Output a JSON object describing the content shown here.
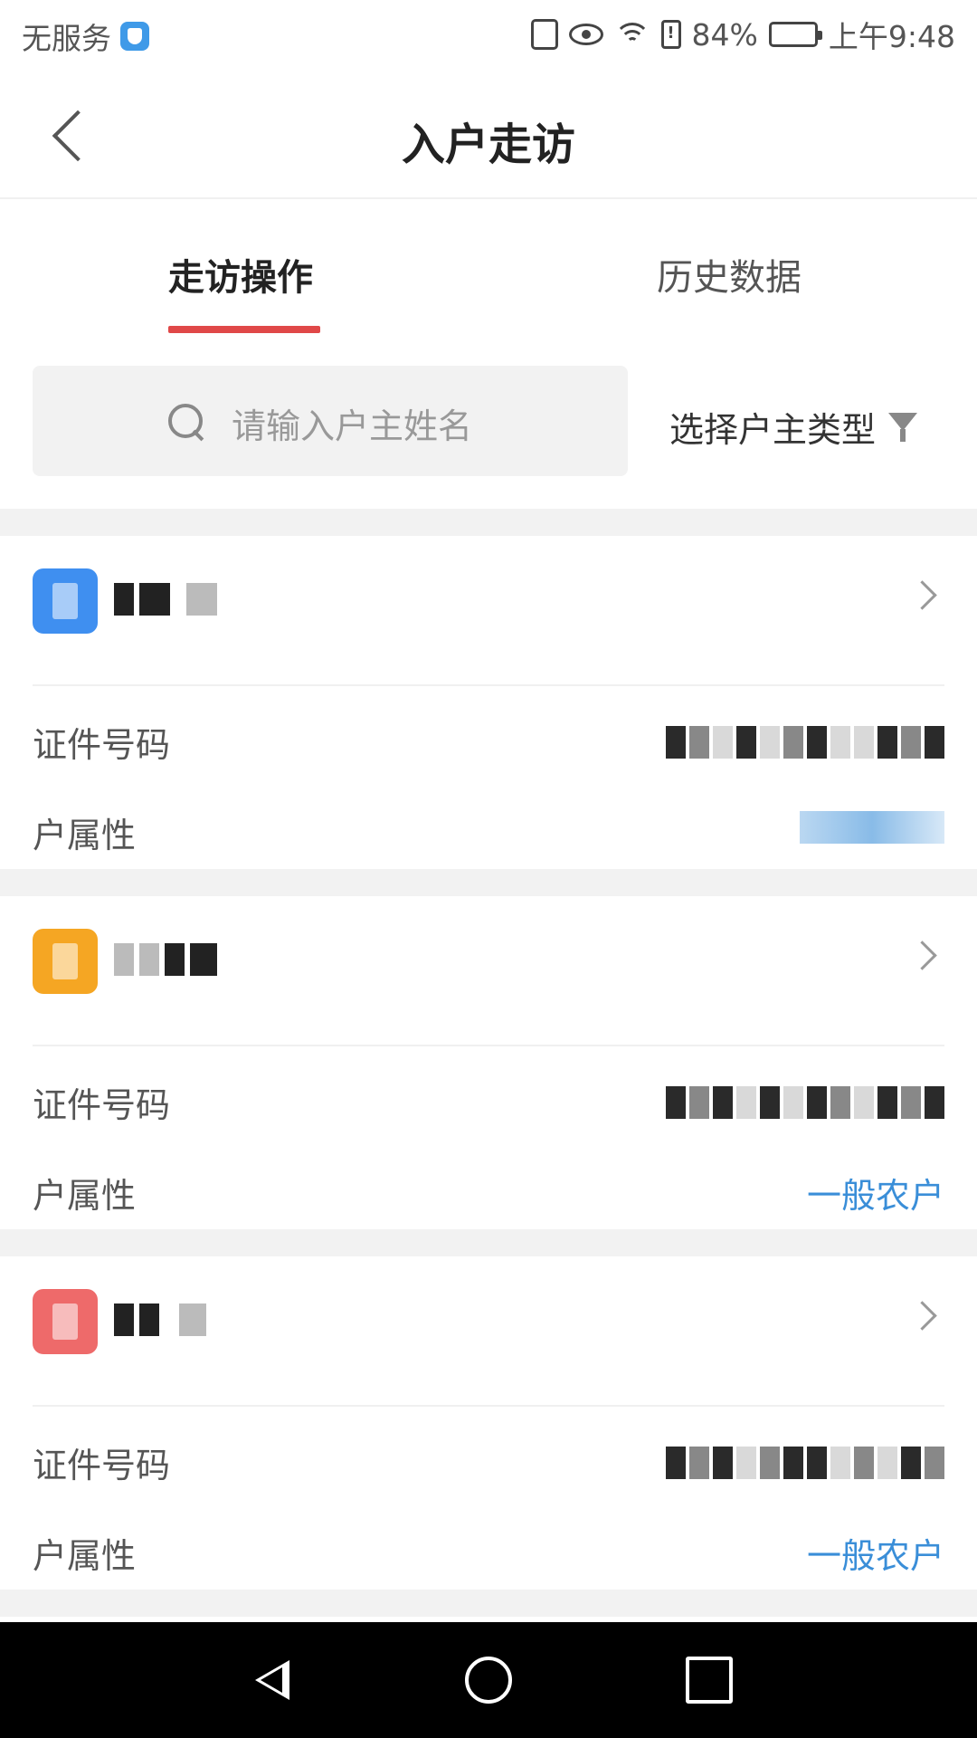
{
  "status_bar": {
    "carrier": "无服务",
    "battery_percent": "84%",
    "battery_level": 0.84,
    "time": "上午9:48",
    "icons": [
      "shield-icon",
      "vibrate-icon",
      "eye-comfort-icon",
      "wifi-icon",
      "battery-alert-icon",
      "battery-icon"
    ]
  },
  "nav": {
    "title": "入户走访",
    "back_icon": "back-arrow-icon"
  },
  "tabs": [
    {
      "label": "走访操作",
      "active": true
    },
    {
      "label": "历史数据",
      "active": false
    }
  ],
  "search": {
    "placeholder": "请输入户主姓名",
    "icon": "search-icon"
  },
  "filter": {
    "label": "选择户主类型",
    "icon": "filter-icon"
  },
  "households": [
    {
      "avatar_color": "#3f8ff0",
      "id_label": "证件号码",
      "attr_label": "户属性",
      "attr_value": ""
    },
    {
      "avatar_color": "#f5a623",
      "id_label": "证件号码",
      "attr_label": "户属性",
      "attr_value": "一般农户"
    },
    {
      "avatar_color": "#ee6a6a",
      "id_label": "证件号码",
      "attr_label": "户属性",
      "attr_value": "一般农户"
    }
  ],
  "system_nav": {
    "icons": [
      "nav-back-icon",
      "nav-home-icon",
      "nav-recents-icon"
    ]
  },
  "colors": {
    "accent_red": "#e04848",
    "link_blue": "#3a8ed8",
    "page_gap": "#f2f2f2"
  }
}
